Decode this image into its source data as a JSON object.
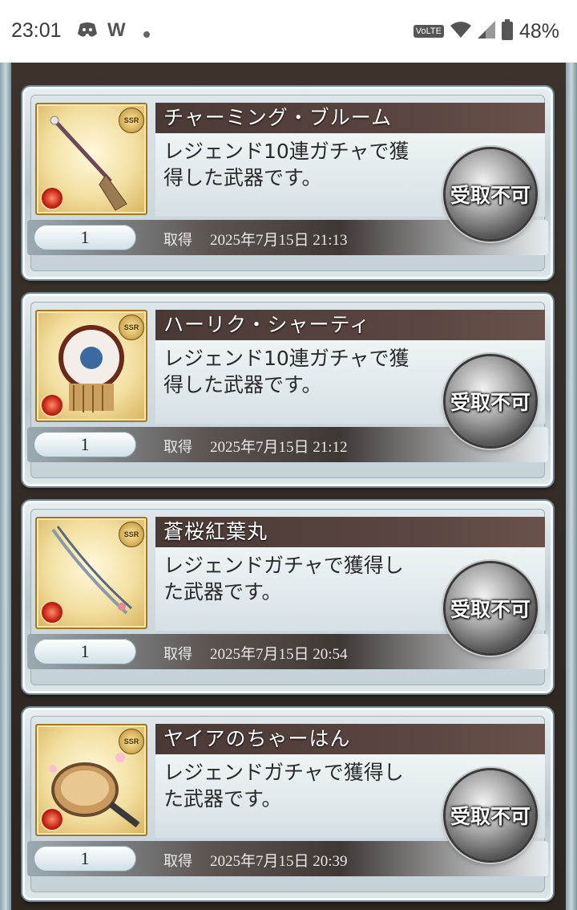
{
  "status_bar": {
    "time": "23:01",
    "notification_icons": [
      "discord-icon",
      "w-app-icon",
      "dot-icon"
    ],
    "volte_label": "VoLTE",
    "battery_percent": "48%"
  },
  "items": [
    {
      "name": "チャーミング・ブルーム",
      "rarity": "SSR",
      "description_line1": "レジェンド10連ガチャで獲",
      "description_line2": "得した武器です。",
      "quantity": "1",
      "acquired_label": "取得",
      "acquired_date": "2025年7月15日 21:13",
      "button_label": "受取不可",
      "icon": "broom-icon"
    },
    {
      "name": "ハーリク・シャーティ",
      "rarity": "SSR",
      "description_line1": "レジェンド10連ガチャで獲",
      "description_line2": "得した武器です。",
      "quantity": "1",
      "acquired_label": "取得",
      "acquired_date": "2025年7月15日 21:12",
      "button_label": "受取不可",
      "icon": "ornament-icon"
    },
    {
      "name": "蒼桜紅葉丸",
      "rarity": "SSR",
      "description_line1": "レジェンドガチャで獲得し",
      "description_line2": "た武器です。",
      "quantity": "1",
      "acquired_label": "取得",
      "acquired_date": "2025年7月15日 20:54",
      "button_label": "受取不可",
      "icon": "sword-icon"
    },
    {
      "name": "ヤイアのちゃーはん",
      "rarity": "SSR",
      "description_line1": "レジェンドガチャで獲得し",
      "description_line2": "た武器です。",
      "quantity": "1",
      "acquired_label": "取得",
      "acquired_date": "2025年7月15日 20:39",
      "button_label": "受取不可",
      "icon": "frying-pan-icon"
    }
  ]
}
